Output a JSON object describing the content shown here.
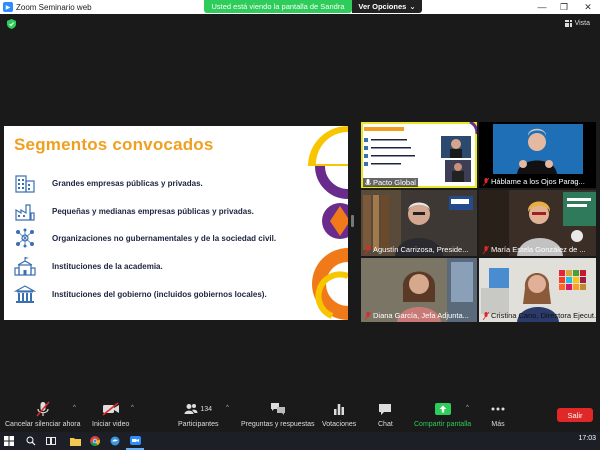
{
  "window": {
    "title": "Zoom Seminario web",
    "share_banner": "Usted está viendo la pantalla de Sandra",
    "view_options": "Ver Opciones",
    "view_options_caret": "⌄",
    "minimize": "—",
    "maximize": "❐",
    "close": "✕"
  },
  "top": {
    "view_label": "Vista"
  },
  "slide": {
    "title": "Segmentos convocados",
    "items": [
      {
        "label": "Grandes empresas públicas y privadas.",
        "icon": "building-icon"
      },
      {
        "label": "Pequeñas y medianas empresas públicas y privadas.",
        "icon": "factory-icon"
      },
      {
        "label": "Organizaciones no gubernamentales y de la sociedad civil.",
        "icon": "network-icon"
      },
      {
        "label": "Instituciones de la academia.",
        "icon": "school-icon"
      },
      {
        "label": "Instituciones del gobierno (incluidos gobiernos locales).",
        "icon": "government-icon"
      }
    ],
    "colors": {
      "title": "#f0a020",
      "text": "#1d2340",
      "purple": "#6a2c8c",
      "yellow": "#f7c600",
      "orange": "#f07a1a"
    }
  },
  "gallery": [
    {
      "name": "Pacto Global",
      "muted": false,
      "active": true
    },
    {
      "name": "Háblame a los Ojos Parag...",
      "muted": true,
      "active": false
    },
    {
      "name": "Agustín Carrizosa, Preside...",
      "muted": true,
      "active": false
    },
    {
      "name": "María Estela González de ...",
      "muted": true,
      "active": false
    },
    {
      "name": "Diana García, Jefa Adjunta...",
      "muted": true,
      "active": false
    },
    {
      "name": "Cristina Cano, Directora Ejecut...",
      "muted": true,
      "active": false
    }
  ],
  "toolbar": {
    "mute_label": "Cancelar silenciar ahora",
    "video_label": "Iniciar video",
    "participants_label": "Participantes",
    "participants_count": "134",
    "qa_label": "Preguntas y respuestas",
    "polls_label": "Votaciones",
    "chat_label": "Chat",
    "share_label": "Compartir pantalla",
    "more_label": "Más",
    "leave_label": "Salir",
    "caret": "^"
  },
  "taskbar": {
    "clock": "17:03"
  }
}
